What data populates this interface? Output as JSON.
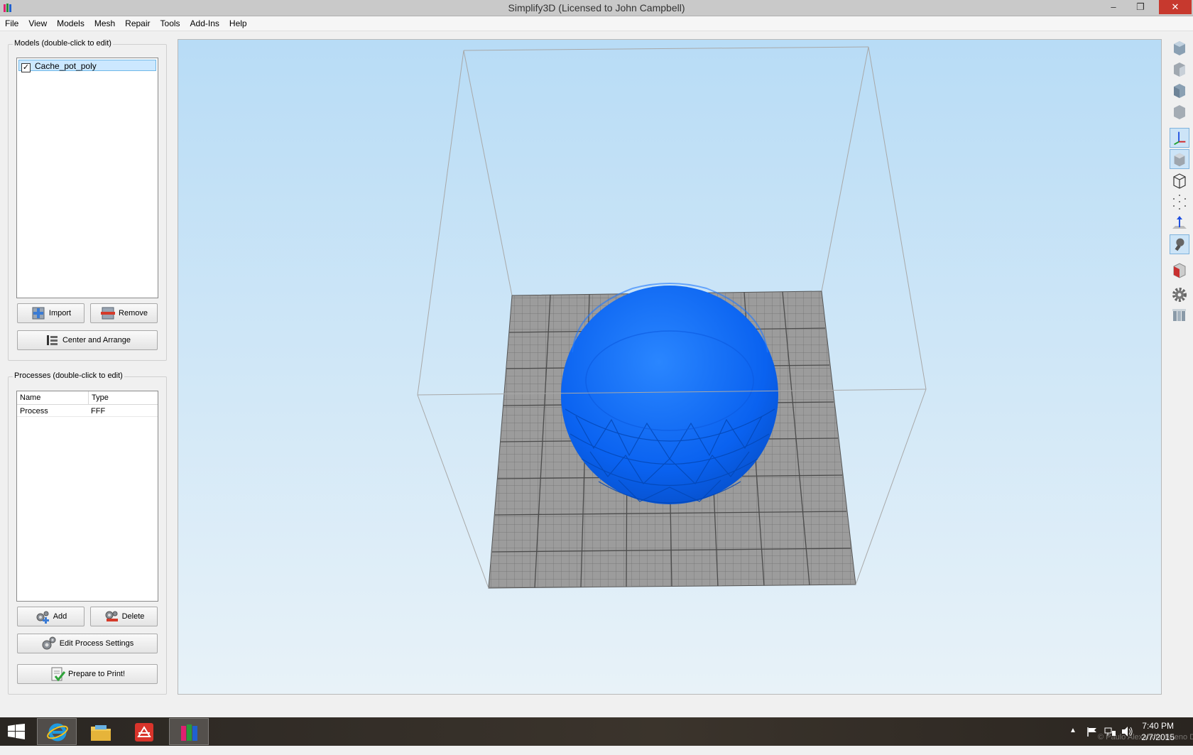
{
  "window": {
    "title": "Simplify3D (Licensed to John Campbell)",
    "minimize_glyph": "‒",
    "restore_glyph": "❐",
    "close_glyph": "✕"
  },
  "menu": [
    "File",
    "View",
    "Models",
    "Mesh",
    "Repair",
    "Tools",
    "Add-Ins",
    "Help"
  ],
  "models_panel": {
    "title": "Models (double-click to edit)",
    "items": [
      {
        "name": "Cache_pot_poly",
        "checked": true
      }
    ],
    "import_label": "Import",
    "remove_label": "Remove",
    "center_label": "Center and Arrange"
  },
  "processes_panel": {
    "title": "Processes (double-click to edit)",
    "columns": [
      "Name",
      "Type"
    ],
    "rows": [
      {
        "name": "Process",
        "type": "FFF"
      }
    ],
    "add_label": "Add",
    "delete_label": "Delete",
    "edit_label": "Edit Process Settings",
    "prepare_label": "Prepare to Print!"
  },
  "toolbar_icons": [
    "view-cube-icon",
    "view-cube-icon",
    "view-cube-icon",
    "view-cube-icon",
    "axes-icon",
    "solid-view-icon",
    "wireframe-icon",
    "point-cloud-icon",
    "normals-icon",
    "lighting-icon",
    "cross-section-icon",
    "settings-gear-icon",
    "tool-paths-icon"
  ],
  "model_color": "#0a62f0",
  "taskbar": {
    "time": "7:40 PM",
    "date": "2/7/2015",
    "watermark": "© Paulo Alexandre Bueno Dias"
  }
}
